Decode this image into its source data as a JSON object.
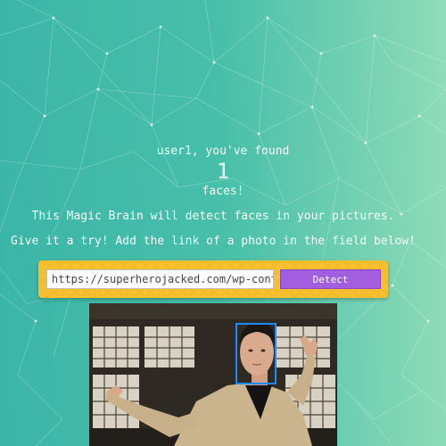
{
  "rank": {
    "greeting": "user1, you've found",
    "count": "1",
    "suffix": "faces!"
  },
  "intro": {
    "description": "This Magic Brain will detect faces in your pictures.",
    "call_to_action": "Give it a try! Add the link of a photo in the field below!"
  },
  "form": {
    "input_value": "https://superherojacked.com/wp-content",
    "button_label": "Detect"
  },
  "colors": {
    "background_start": "#3bb5a8",
    "background_end": "#8fdcb8",
    "panel": "#f7c02f",
    "button": "#a35ee0",
    "face_box": "#1a8bff"
  }
}
